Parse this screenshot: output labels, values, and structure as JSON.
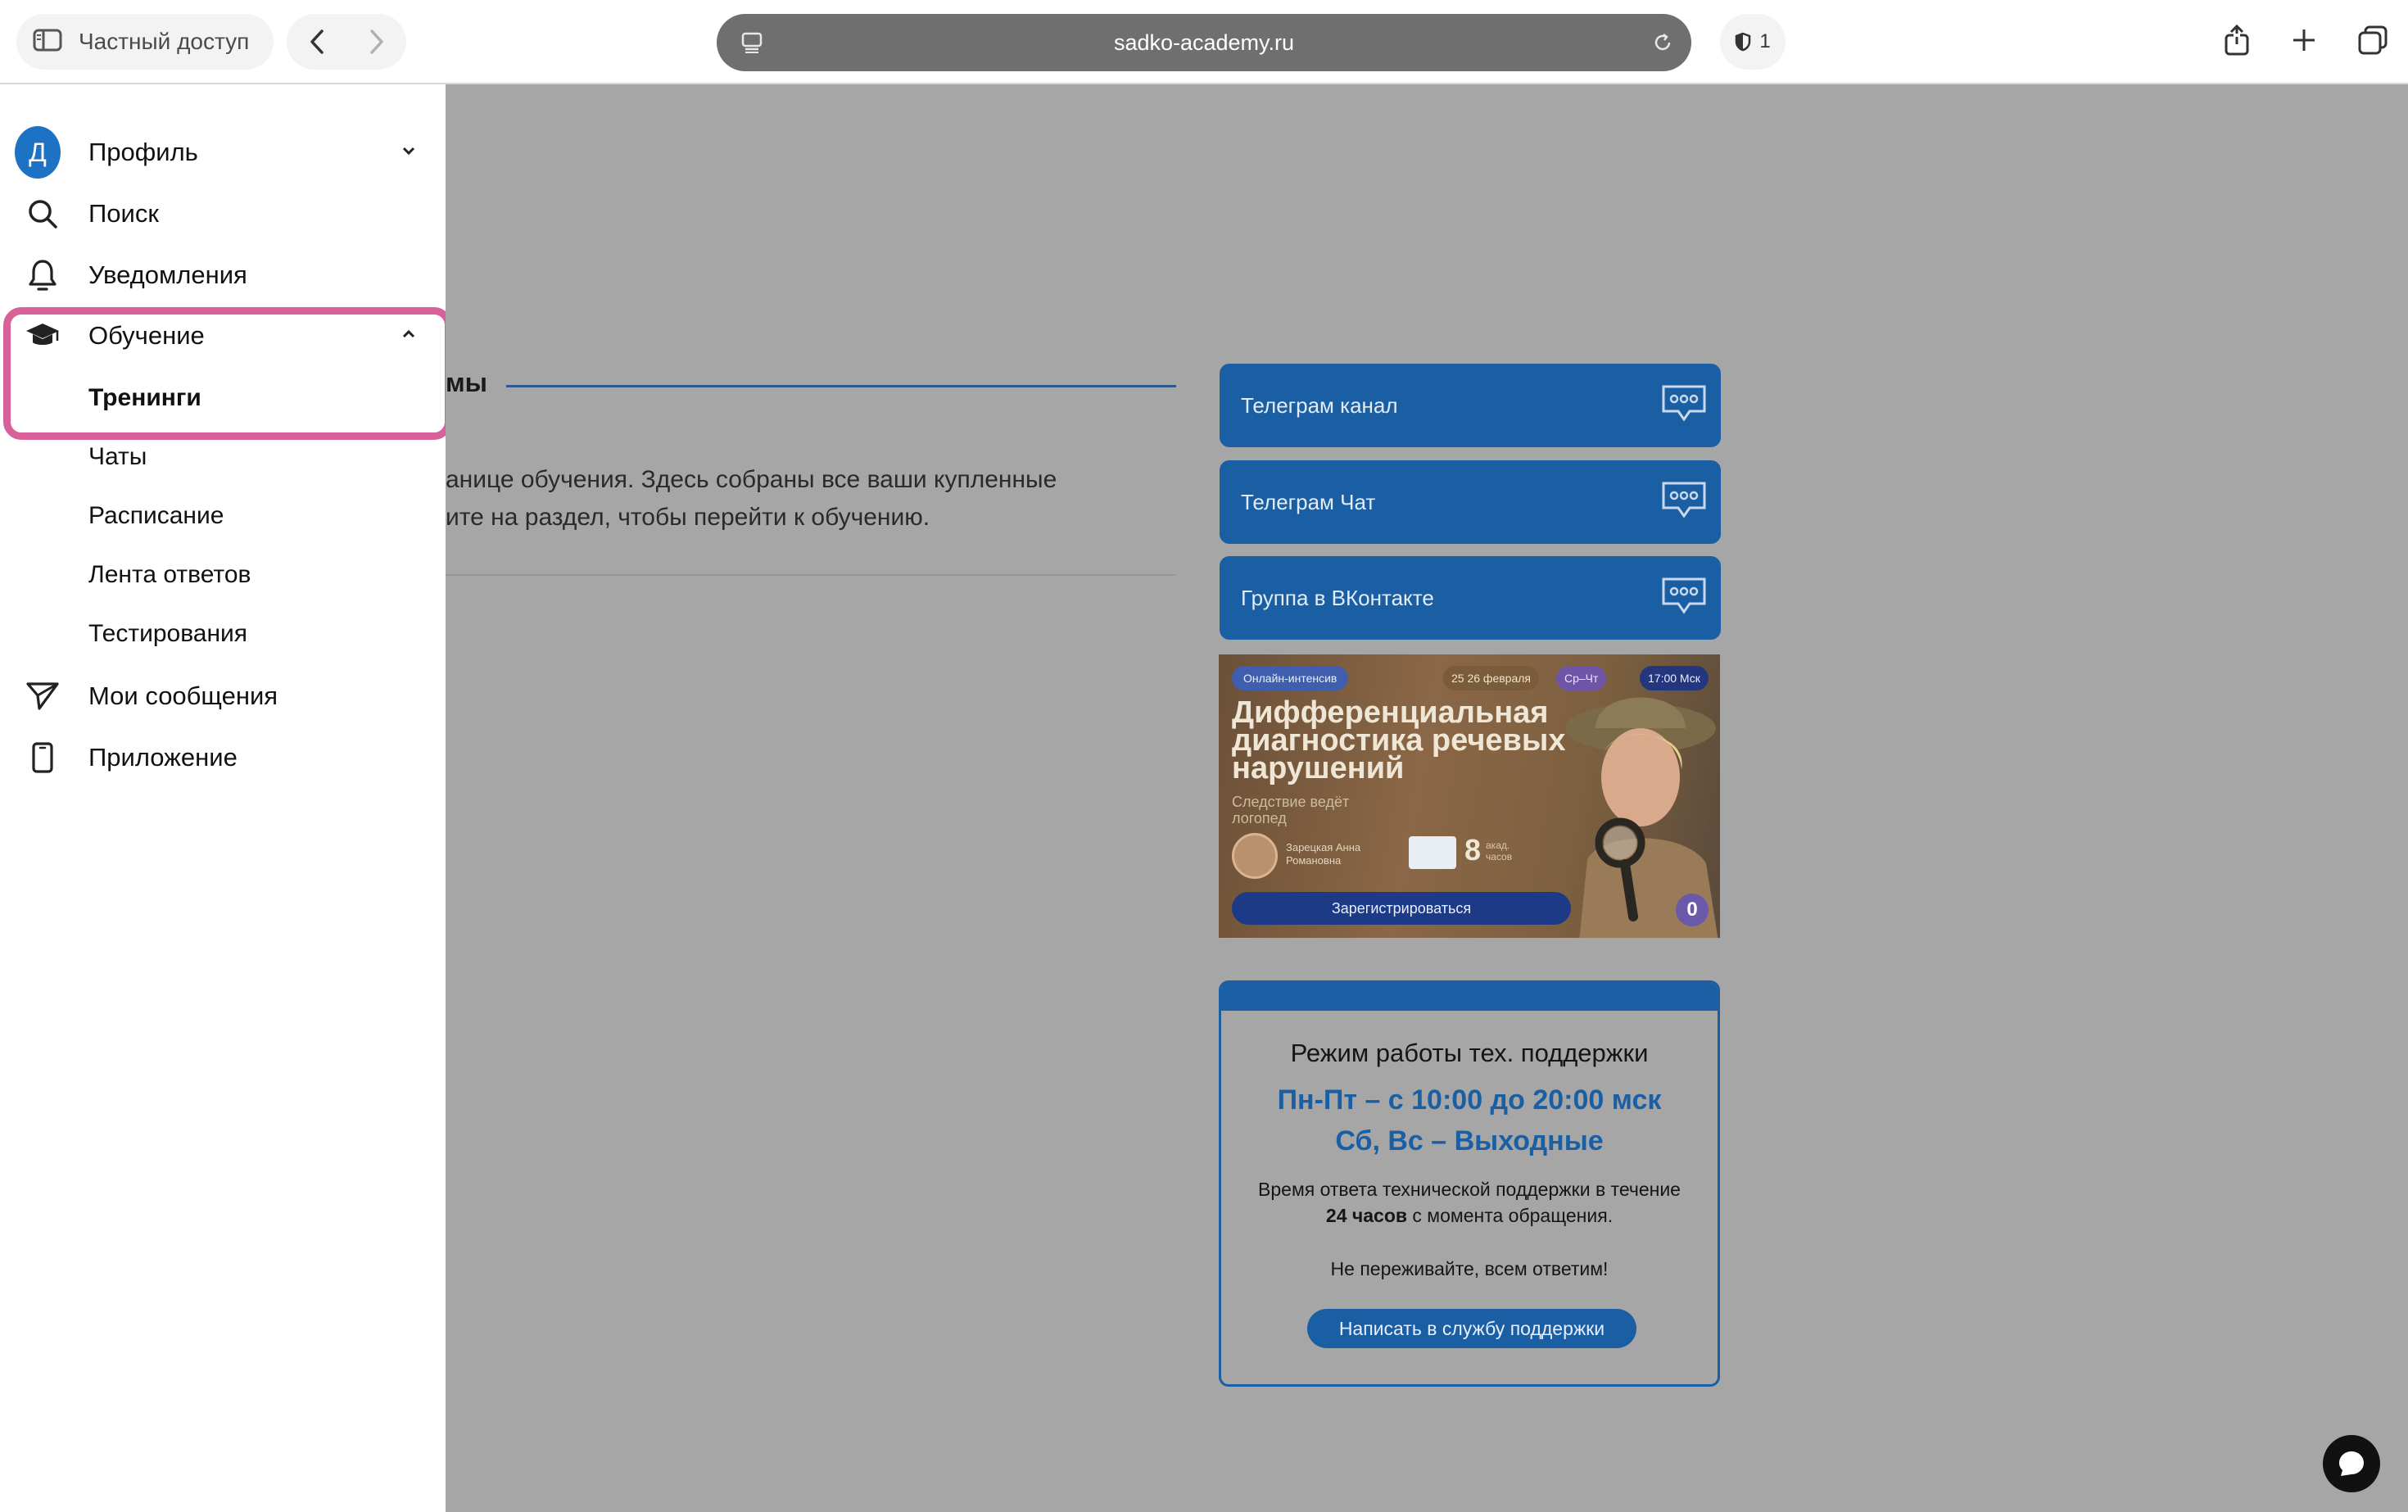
{
  "browser": {
    "private_label": "Частный доступ",
    "address": "sadko-academy.ru",
    "shield_count": "1"
  },
  "sidebar": {
    "items": [
      {
        "label": "Профиль",
        "avatar": "Д"
      },
      {
        "label": "Поиск"
      },
      {
        "label": "Уведомления"
      },
      {
        "label": "Обучение"
      },
      {
        "label": "Мои сообщения"
      },
      {
        "label": "Приложение"
      }
    ],
    "sub_items": [
      {
        "label": "Тренинги"
      },
      {
        "label": "Чаты"
      },
      {
        "label": "Расписание"
      },
      {
        "label": "Лента ответов"
      },
      {
        "label": "Тестирования"
      }
    ]
  },
  "main": {
    "section_title_fragment": "мы",
    "desc_line1": "анице обучения. Здесь собраны все ваши купленные",
    "desc_line2": "ите на раздел, чтобы перейти к обучению."
  },
  "links": [
    {
      "label": "Телеграм канал"
    },
    {
      "label": "Телеграм Чат"
    },
    {
      "label": "Группа в ВКонтакте"
    }
  ],
  "banner": {
    "tag": "Онлайн-интенсив",
    "date": "25 26 февраля",
    "days": "Ср–Чт",
    "time": "17:00 Мск",
    "title": "Дифференциальная диагностика речевых нарушений",
    "subtitle": "Следствие ведёт логопед",
    "author": "Зарецкая Анна Романовна",
    "hours": "8",
    "hours_sub": "акад. часов",
    "cta": "Зарегистрироваться",
    "badge": "0"
  },
  "support": {
    "title": "Режим работы тех. поддержки",
    "hours_1": "Пн-Пт – с 10:00 до 20:00 мск",
    "hours_2": "Сб, Вс – Выходные",
    "note_1": "Время ответа технической поддержки в течение",
    "note_bold": "24 часов",
    "note_2": "с момента обращения.",
    "calm": "Не переживайте, всем ответим!",
    "button": "Написать в службу поддержки"
  },
  "colors": {
    "accent_blue": "#1a5fa3",
    "highlight_pink": "#d9619a",
    "avatar_blue": "#1e72c4"
  }
}
